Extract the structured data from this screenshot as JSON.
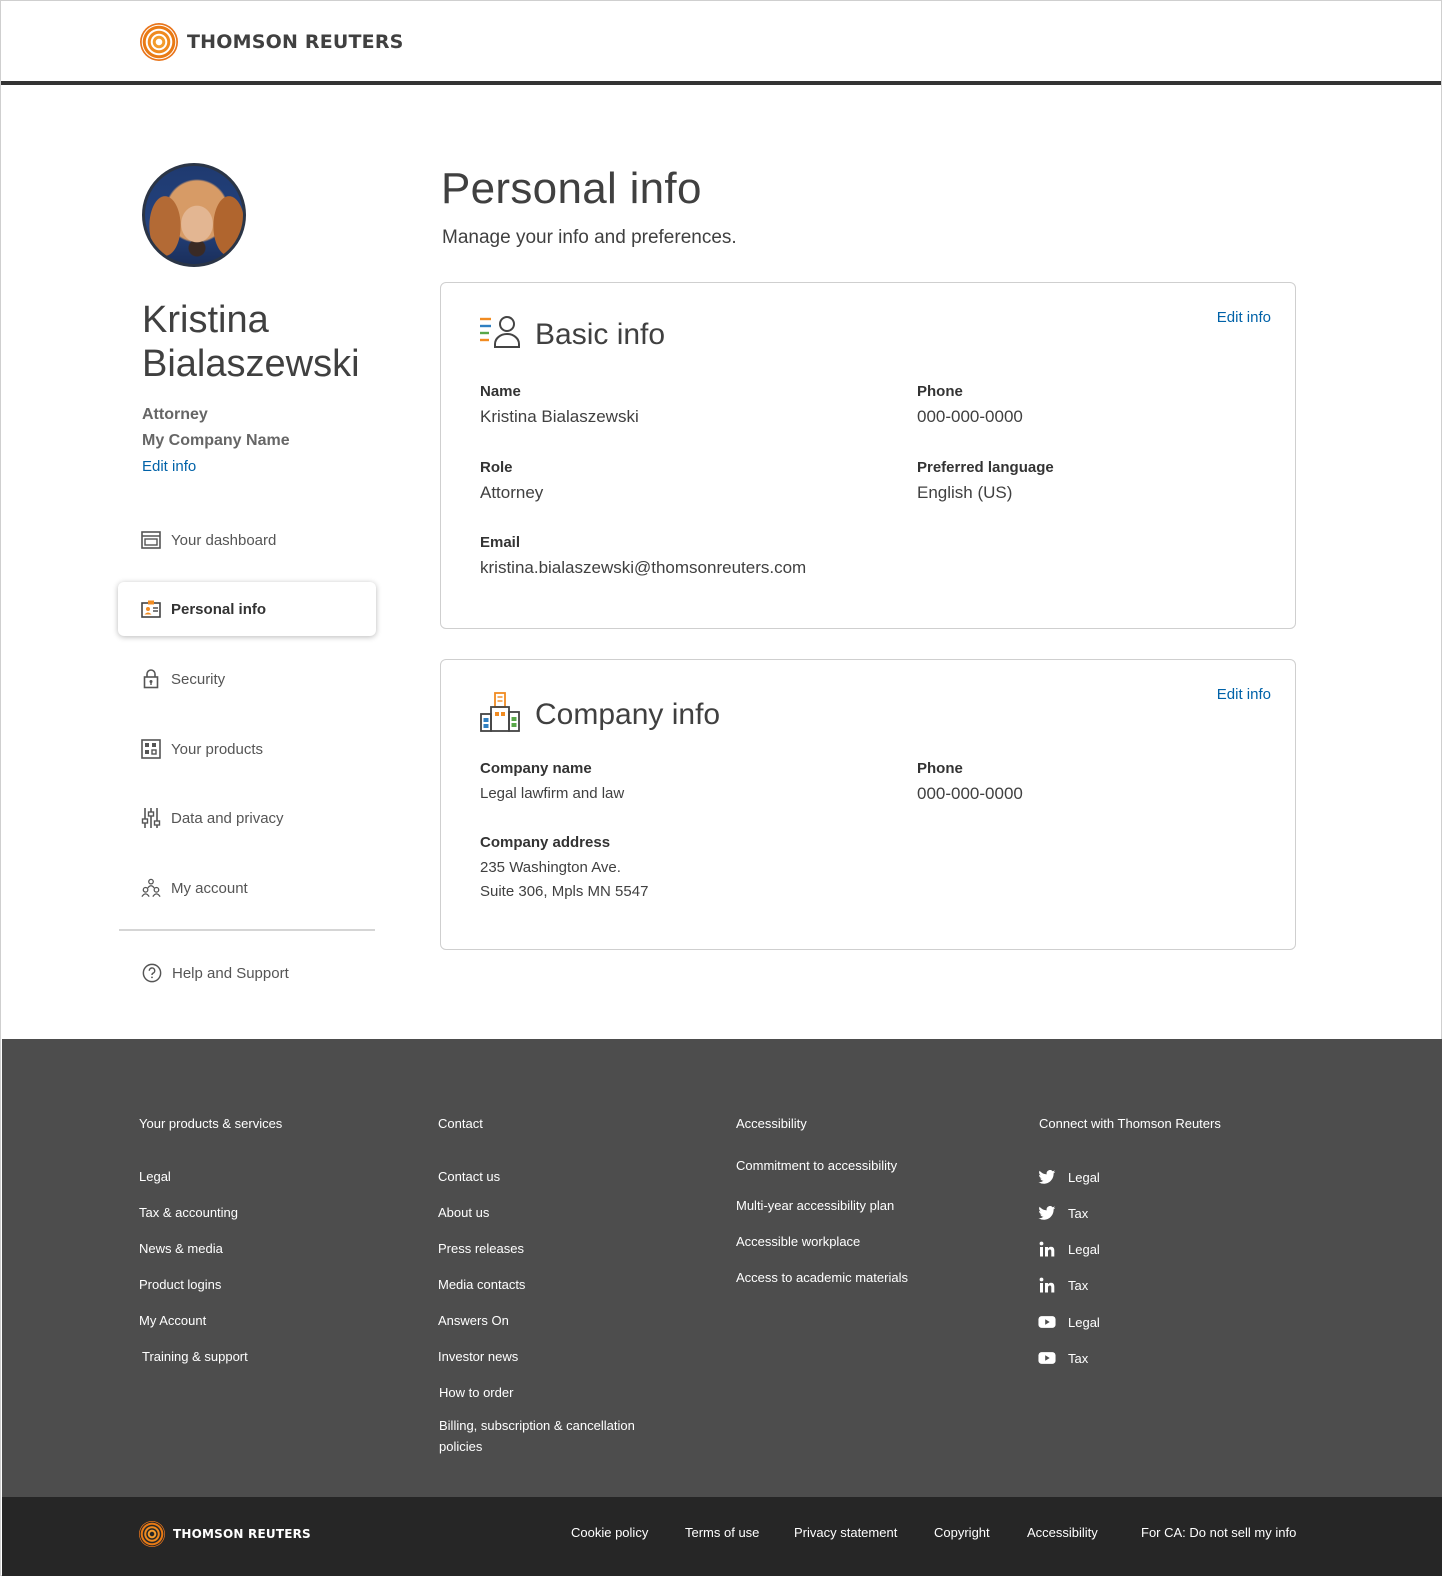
{
  "header": {
    "logo_text": "THOMSON REUTERS"
  },
  "sidebar": {
    "user_name": "Kristina Bialaszewski",
    "user_role": "Attorney",
    "user_company": "My Company Name",
    "edit_label": "Edit info",
    "nav": [
      {
        "label": "Your dashboard",
        "icon": "dashboard-icon"
      },
      {
        "label": "Personal info",
        "icon": "id-card-icon",
        "active": true
      },
      {
        "label": "Security",
        "icon": "lock-icon"
      },
      {
        "label": "Your products",
        "icon": "products-grid-icon"
      },
      {
        "label": "Data and privacy",
        "icon": "sliders-icon"
      },
      {
        "label": "My account",
        "icon": "account-users-icon"
      }
    ],
    "help_label": "Help and Support"
  },
  "main": {
    "title": "Personal info",
    "subtitle": "Manage your info and preferences.",
    "basic": {
      "title": "Basic info",
      "edit_label": "Edit info",
      "fields": {
        "name": {
          "label": "Name",
          "value": "Kristina Bialaszewski"
        },
        "phone": {
          "label": "Phone",
          "value": "000-000-0000"
        },
        "role": {
          "label": "Role",
          "value": "Attorney"
        },
        "language": {
          "label": "Preferred language",
          "value": "English (US)"
        },
        "email": {
          "label": "Email",
          "value": "kristina.bialaszewski@thomsonreuters.com"
        }
      }
    },
    "company": {
      "title": "Company info",
      "edit_label": "Edit info",
      "fields": {
        "name": {
          "label": "Company name",
          "value": "Legal lawfirm and law"
        },
        "phone": {
          "label": "Phone",
          "value": "000-000-0000"
        },
        "address": {
          "label": "Company address",
          "line1": "235 Washington Ave.",
          "line2": "Suite 306, Mpls MN 5547"
        }
      }
    }
  },
  "footer": {
    "products": {
      "heading": "Your products & services",
      "links": [
        "Legal",
        "Tax & accounting",
        "News & media",
        "Product logins",
        "My Account",
        "Training & support"
      ]
    },
    "contact": {
      "heading": "Contact",
      "links": [
        "Contact us",
        "About us",
        "Press releases",
        "Media contacts",
        "Answers On",
        "Investor news",
        "How to order"
      ],
      "billing_line1": "Billing, subscription & cancellation",
      "billing_line2": "policies"
    },
    "accessibility": {
      "heading": "Accessibility",
      "links": [
        "Commitment to accessibility",
        "Multi-year accessibility plan",
        "Accessible workplace",
        "Access to academic materials"
      ]
    },
    "connect": {
      "heading": "Connect with Thomson Reuters",
      "links": [
        {
          "icon": "twitter-icon",
          "label": "Legal"
        },
        {
          "icon": "twitter-icon",
          "label": "Tax"
        },
        {
          "icon": "linkedin-icon",
          "label": "Legal"
        },
        {
          "icon": "linkedin-icon",
          "label": "Tax"
        },
        {
          "icon": "youtube-icon",
          "label": "Legal"
        },
        {
          "icon": "youtube-icon",
          "label": "Tax"
        }
      ]
    }
  },
  "bottom_bar": {
    "logo_text": "THOMSON REUTERS",
    "links": [
      "Cookie policy",
      "Terms of use",
      "Privacy statement",
      "Copyright",
      "Accessibility",
      "For CA: Do not sell my info"
    ]
  },
  "colors": {
    "accent_link": "#0062a8",
    "brand_orange": "#f18b21",
    "footer_bg": "#4d4d4d",
    "bottom_bg": "#262626"
  }
}
